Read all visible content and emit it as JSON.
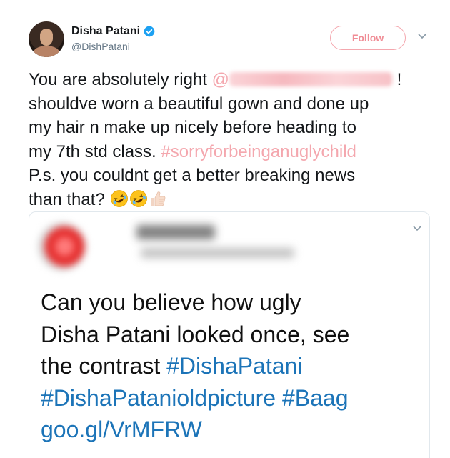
{
  "author": {
    "name": "Disha Patani",
    "handle": "@DishPatani",
    "verified": true
  },
  "actions": {
    "follow_label": "Follow",
    "menu_icon": "chevron-down-icon"
  },
  "tweet": {
    "l1_a": "You are absolutely right ",
    "l1_mention_at": "@",
    "l1_b": " !",
    "l2": "shouldve worn a beautiful gown and done up",
    "l3": "my hair n make up nicely before heading to",
    "l4_a": "my 7th std class. ",
    "l4_hashtag": "#sorryforbeinganuglychild",
    "l5": "P.s. you couldnt get a better breaking news",
    "l6": "than that? ",
    "emojis": [
      "rolling-on-floor-laughing-emoji",
      "rolling-on-floor-laughing-emoji",
      "thumbs-up-emoji"
    ]
  },
  "quoted": {
    "l1": "Can you believe how ugly",
    "l2": "Disha Patani looked once, see",
    "l3_a": "the contrast ",
    "l3_hashtag": "#DishaPatani",
    "l4_hashtag1": "#DishaPatanioldpicture",
    "l4_sep": " ",
    "l4_hashtag2": "#Baag",
    "l5_link": "goo.gl/VrMFRW"
  },
  "colors": {
    "pink_accent": "#f4a7ae",
    "link_blue": "#1c74b8",
    "verified_blue": "#1da1f2"
  }
}
